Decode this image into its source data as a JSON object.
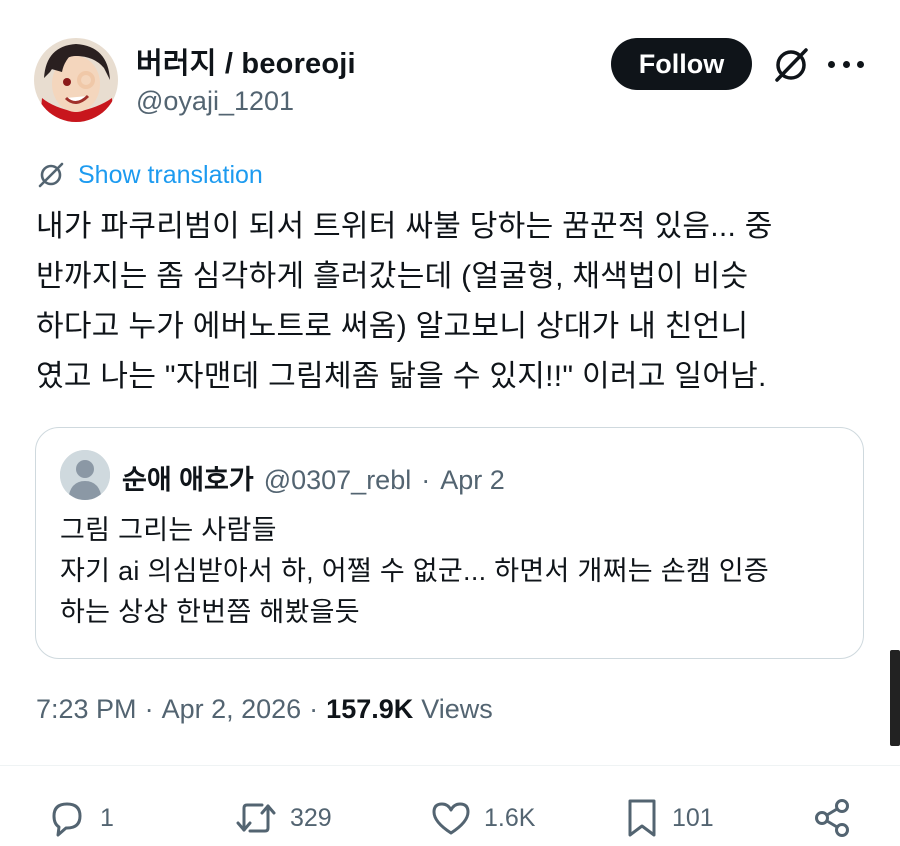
{
  "author": {
    "display_name": "버러지 / beoreoji",
    "handle": "@oyaji_1201"
  },
  "header": {
    "follow_label": "Follow",
    "grok_icon": "grok-icon",
    "more_icon": "more-dots-icon"
  },
  "translation": {
    "label": "Show translation",
    "icon": "grok-icon"
  },
  "tweet": {
    "text": "내가 파쿠리범이 되서 트위터 싸불 당하는 꿈꾼적 있음... 중\n반까지는 좀 심각하게 흘러갔는데 (얼굴형, 채색법이 비슷\n하다고 누가 에버노트로 써옴) 알고보니 상대가 내 친언니\n였고 나는 \"자맨데 그림체좀 닮을 수 있지!!\" 이러고 일어남."
  },
  "quote": {
    "name": "순애 애호가",
    "handle": "@0307_rebl",
    "dot": "·",
    "date": "Apr 2",
    "text": "그림 그리는 사람들\n자기 ai 의심받아서 하, 어쩔 수 없군... 하면서 개쩌는 손캠 인증\n하는 상상 한번쯤 해봤을듯"
  },
  "meta": {
    "time": "7:23 PM",
    "sep1": "·",
    "date": "Apr 2, 2026",
    "sep2": "·",
    "views_count": "157.9K",
    "views_label": "Views"
  },
  "actions": {
    "replies": "1",
    "reposts": "329",
    "likes": "1.6K",
    "bookmarks": "101"
  },
  "colors": {
    "accent": "#1d9bf0",
    "text": "#0f1419",
    "muted": "#536471",
    "border": "#cfd9de"
  }
}
